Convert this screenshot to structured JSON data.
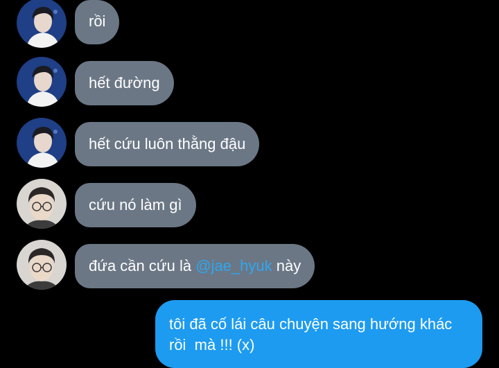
{
  "messages": [
    {
      "avatar": "avatar-person-a",
      "text": "rồi"
    },
    {
      "avatar": "avatar-person-a",
      "text": "hết đường"
    },
    {
      "avatar": "avatar-person-a",
      "text": "hết cứu luôn thằng đậu"
    },
    {
      "avatar": "avatar-person-b",
      "text": "cứu nó làm gì"
    },
    {
      "avatar": "avatar-person-b",
      "text_before": "đứa cần cứu là ",
      "mention": "@jae_hyuk",
      "text_after": " này"
    }
  ],
  "outgoing": {
    "line1": "tôi đã cố lái câu chuyện sang hướng khác",
    "line2": "rồi  mà !!! (x)"
  },
  "colors": {
    "background": "#000000",
    "incoming_bubble": "#6b7785",
    "outgoing_bubble": "#1d9bf0",
    "mention": "#2ea7f2"
  }
}
